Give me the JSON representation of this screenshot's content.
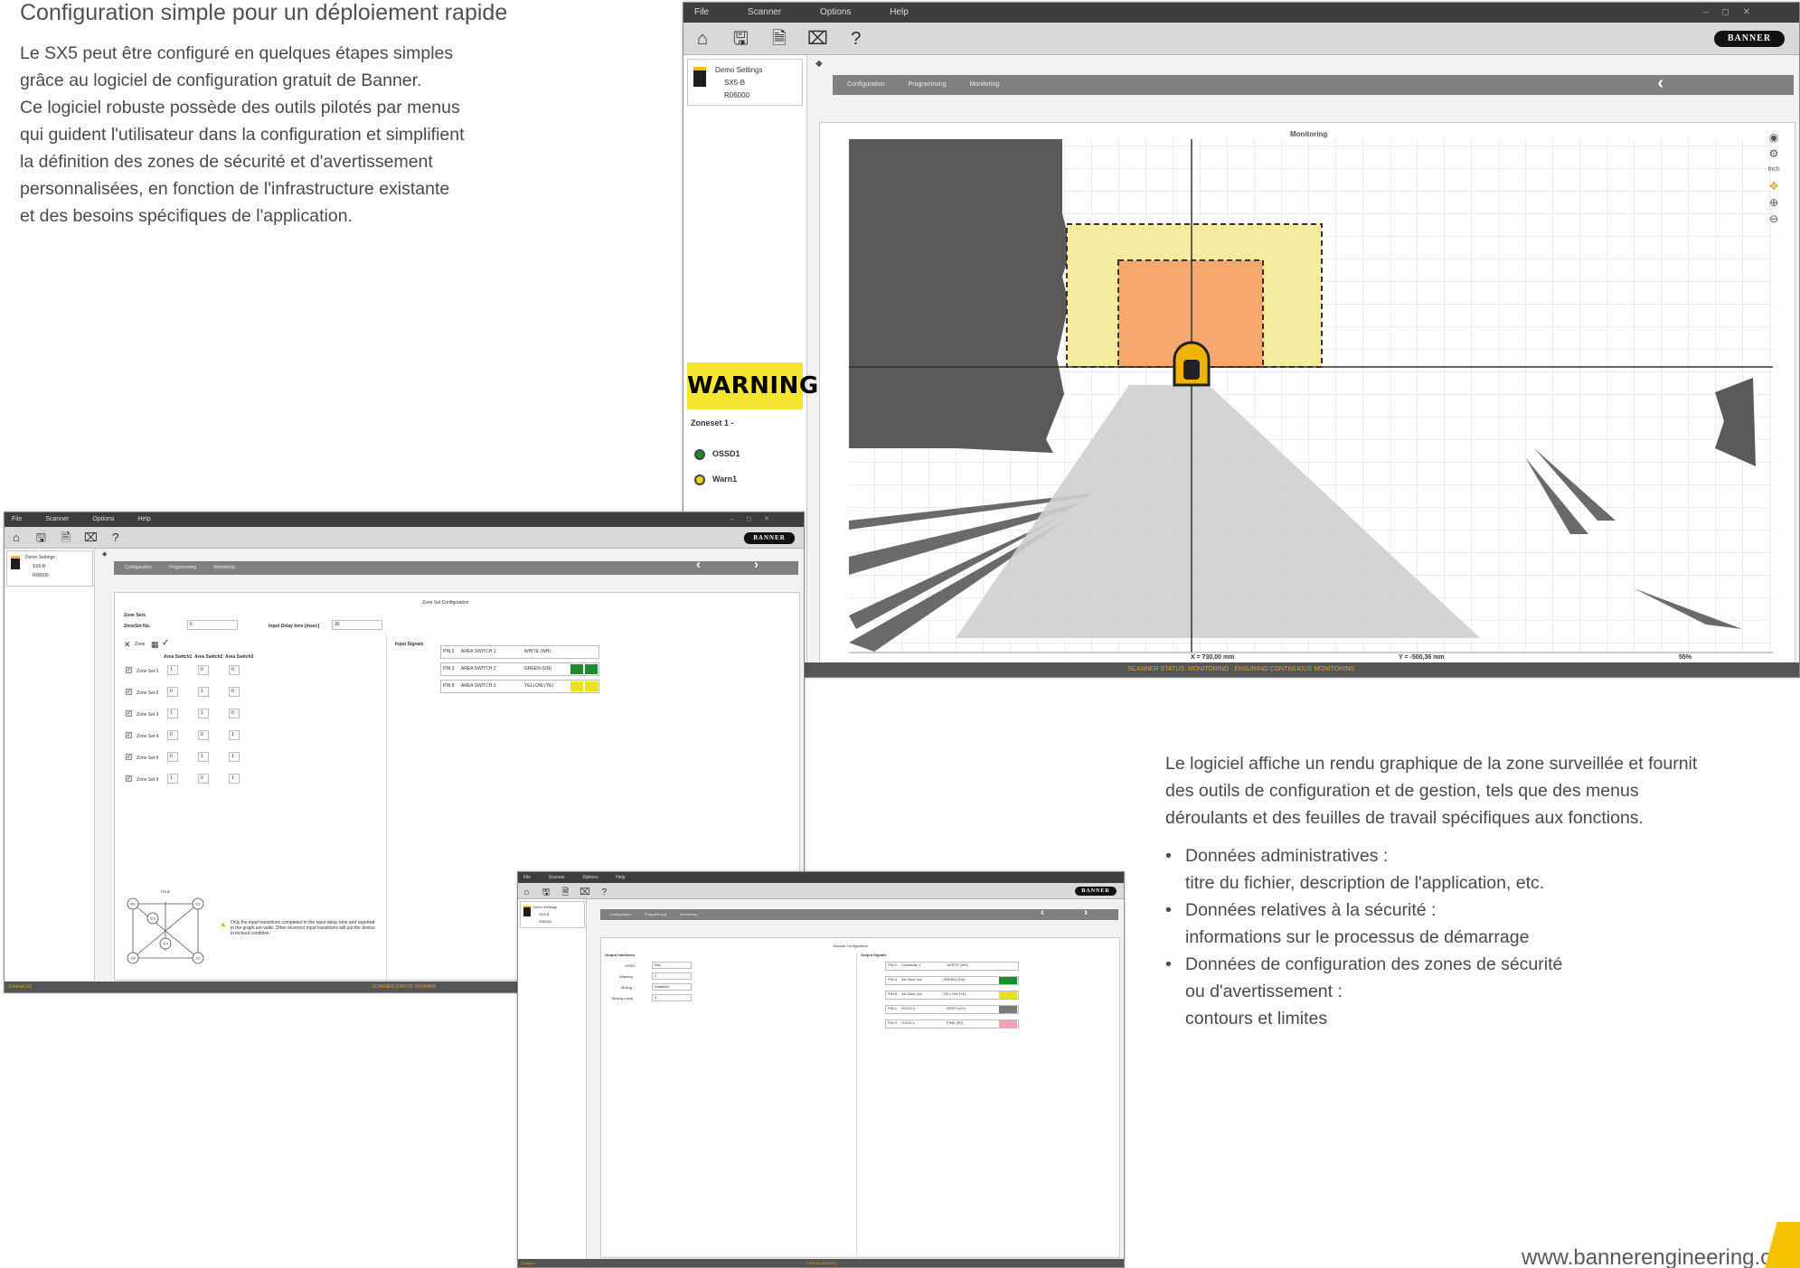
{
  "brochure": {
    "title": "Configuration simple pour un déploiement rapide",
    "intro_lines": [
      "Le SX5 peut être configuré en quelques étapes simples",
      "grâce au logiciel de configuration gratuit de Banner.",
      "Ce logiciel robuste possède des outils pilotés par menus",
      "qui guident l'utilisateur dans la configuration et simplifient",
      "la définition des zones de sécurité et d'avertissement",
      "personnalisées, en fonction de l'infrastructure existante",
      "et des besoins spécifiques de l'application."
    ],
    "desc_lines": [
      "Le logiciel affiche un rendu graphique de la zone surveillée et fournit",
      "des outils de configuration et de gestion, tels que des menus",
      "déroulants et des feuilles de travail spécifiques aux fonctions."
    ],
    "bullets": [
      {
        "title": "Données administratives :",
        "detail": "titre du fichier, description de l'application, etc."
      },
      {
        "title": "Données relatives à la sécurité :",
        "detail": "informations sur le processus de démarrage"
      },
      {
        "title": "Données de configuration des zones de sécurité",
        "detail": "ou d'avertissement :",
        "detail2": "contours et limites"
      }
    ],
    "website": "www.bannerengineering.co",
    "accent_color": "#f4c300"
  },
  "main_window": {
    "menu": [
      "File",
      "Scanner",
      "Options",
      "Help"
    ],
    "window_controls": "– ◻ ✕",
    "toolbar_icons": [
      "home-icon",
      "save-icon",
      "open-file-icon",
      "device-icon",
      "help-icon"
    ],
    "toolbar_glyphs": [
      "⌂",
      "🖫",
      "🗎",
      "⌧",
      "?"
    ],
    "logo": "BANNER",
    "device": {
      "name": "Demo Settings",
      "model": "SX5-B",
      "serial": "R06000"
    },
    "nav_tabs": [
      "Configuration",
      "Programming",
      "Monitoring"
    ],
    "back_arrow": "‹",
    "status_indicator": "WARNING",
    "zoneset": "Zoneset 1 -",
    "outputs": [
      {
        "label": "OSSD1",
        "color": "#1e8a2a"
      },
      {
        "label": "Warn1",
        "color": "#e7d21b"
      }
    ],
    "plot_title": "Monitoring",
    "plot_tools": [
      "camera-icon",
      "settings-icon",
      "units-label",
      "pan-icon",
      "zoom-in-icon",
      "zoom-out-icon"
    ],
    "plot_tool_glyphs": [
      "◉",
      "⚙",
      "Inch",
      "✥",
      "⊕",
      "⊖"
    ],
    "readout_x": "X = 730,00 mm",
    "readout_y": "Y = -500,36 mm",
    "readout_pct": "55%",
    "status_bar": "SCANNER STATUS: MONITORING - ENSURING CONTINUOUS MONITORING",
    "colors": {
      "warning_zone": "#f5ec9e",
      "safety_zone": "#f6a86f",
      "shadow": "#585858",
      "scanner": "#f0b400"
    }
  },
  "zone_window": {
    "menu": [
      "File",
      "Scanner",
      "Options",
      "Help"
    ],
    "logo": "BANNER",
    "device": {
      "name": "Demo Settings",
      "model": "SX5-B",
      "serial": "R06000"
    },
    "nav_tabs": [
      "Configuration",
      "Programming",
      "Monitoring"
    ],
    "panel_title": "Zone Set Configuration",
    "zone_sets_label": "Zone Sets",
    "zoneset_no_label": "ZoneSet No.",
    "zoneset_no_value": "6",
    "input_delay_label": "Input Delay time [msec]",
    "input_delay_value": "30",
    "zone_label": "Zone",
    "col_headers": [
      "Area Switch1",
      "Area Switch2",
      "Area Switch3"
    ],
    "rows": [
      {
        "name": "Zone Set 1",
        "v": [
          "1",
          "0",
          "0"
        ]
      },
      {
        "name": "Zone Set 2",
        "v": [
          "0",
          "1",
          "0"
        ]
      },
      {
        "name": "Zone Set 3",
        "v": [
          "1",
          "1",
          "0"
        ]
      },
      {
        "name": "Zone Set 4",
        "v": [
          "0",
          "0",
          "1"
        ]
      },
      {
        "name": "Zone Set 5",
        "v": [
          "0",
          "1",
          "1"
        ]
      },
      {
        "name": "Zone Set 6",
        "v": [
          "1",
          "0",
          "1"
        ]
      }
    ],
    "input_signals_label": "Input Signals",
    "signals": [
      {
        "pin": "PIN 5",
        "sel": "AREA SWITCH 1",
        "wire": "WHITE (WH)",
        "c1": "#ffffff",
        "c2": "#ffffff"
      },
      {
        "pin": "PIN 3",
        "sel": "AREA SWITCH 2",
        "wire": "GREEN (GN)",
        "c1": "#1d8c2e",
        "c2": "#1d8c2e"
      },
      {
        "pin": "PIN 8",
        "sel": "AREA SWITCH 3",
        "wire": "YELLOW (YE)",
        "c1": "#e9e01e",
        "c2": "#e9e01e"
      }
    ],
    "diagram_title": "TRUE",
    "diagram_nodes": [
      "001",
      "011",
      "010",
      "110",
      "100",
      "101"
    ],
    "note": "Only the input transitions completed in the input delay time and reported in the graph are valid. Other incorrect input transitions will put the device in lockout condition.",
    "status_left": "Zoneset 1/1",
    "status_bar": "SCANNER STATUS: RUNNING"
  },
  "output_window": {
    "menu": [
      "File",
      "Scanner",
      "Options",
      "Help"
    ],
    "logo": "BANNER",
    "device": {
      "name": "Demo Settings",
      "model": "SX5-B",
      "serial": "R06000"
    },
    "nav_tabs": [
      "Configuration",
      "Programming",
      "Monitoring"
    ],
    "panel_title": "Outputs Configuration",
    "output_interfaces_label": "Output Interfaces",
    "output_signals_label": "Output Signals",
    "fields": [
      {
        "label": "OSSD",
        "value": "N/A"
      },
      {
        "label": "Warning",
        "value": "1"
      },
      {
        "label": "Muting",
        "value": "Disabled"
      },
      {
        "label": "Muting Lamp",
        "value": "0"
      }
    ],
    "signals": [
      {
        "pin": "PIN 2",
        "sel": "Zonestate 1",
        "wire": "WHITE (WH)",
        "color": "#ffffff"
      },
      {
        "pin": "PIN 3",
        "sel": "AA Zone Ctrl",
        "wire": "GREEN (GN)",
        "color": "#1d8c2e"
      },
      {
        "pin": "PIN 8",
        "sel": "AA Zone Ctrl",
        "wire": "YELLOW (YE)",
        "color": "#e9e01e"
      },
      {
        "pin": "PIN 1",
        "sel": "OSSD 2",
        "wire": "GREY (GY)",
        "color": "#7a7a7a"
      },
      {
        "pin": "PIN 9",
        "sel": "OSSD 1",
        "wire": "PINK (PK)",
        "color": "#f0a3b0"
      }
    ],
    "status_left": "Zoneset",
    "status_bar": "CONFIGURATION"
  }
}
